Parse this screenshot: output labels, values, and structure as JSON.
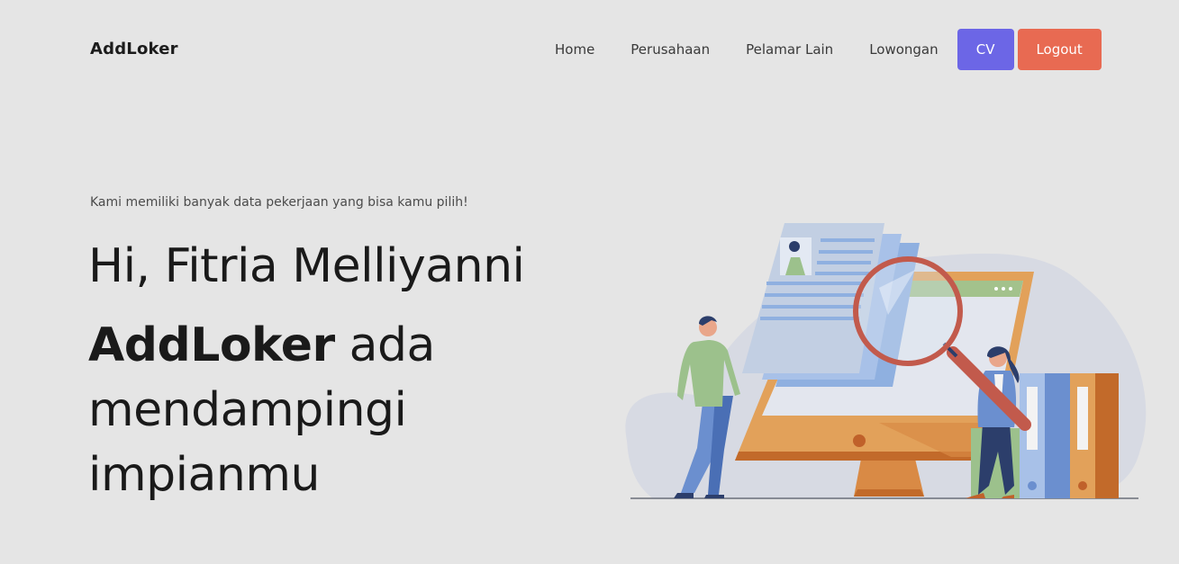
{
  "brand": "AddLoker",
  "nav": {
    "links": [
      "Home",
      "Perusahaan",
      "Pelamar Lain",
      "Lowongan"
    ],
    "cv_label": "CV",
    "logout_label": "Logout"
  },
  "hero": {
    "subtitle": "Kami memiliki banyak data pekerjaan yang bisa kamu pilih!",
    "greeting": "Hi, Fitria Melliyanni",
    "brand_bold": "AddLoker",
    "tagline_rest": " ada mendampingi impianmu"
  },
  "colors": {
    "background": "#e5e5e5",
    "cv_button": "#6c66e6",
    "logout_button": "#e86a52"
  },
  "icons": [
    "job-search-illustration"
  ]
}
